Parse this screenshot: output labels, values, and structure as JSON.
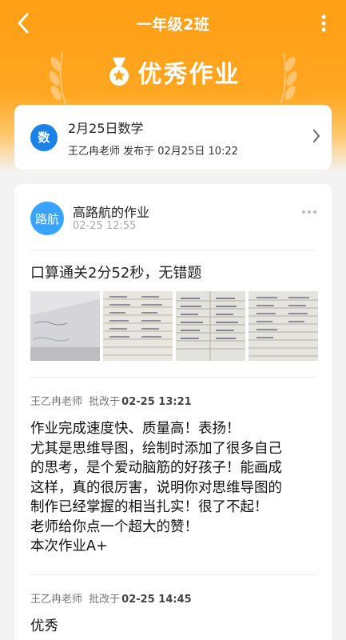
{
  "header": {
    "title": "一年级2班",
    "banner_title": "优秀作业"
  },
  "assignment": {
    "subject_badge": "数",
    "title": "2月25日数学",
    "meta": "王乙冉老师 发布于 02月25日 10:22"
  },
  "submission": {
    "avatar_text": "路航",
    "student_title": "高路航的作业",
    "time": "02-25 12:55",
    "text": "口算通关2分52秒，无错题",
    "photos": [
      "photo-1",
      "photo-2",
      "photo-3",
      "photo-4"
    ]
  },
  "comments": [
    {
      "teacher": "王乙冉老师",
      "action": "批改于",
      "time": "02-25 13:21",
      "lines": [
        "作业完成速度快、质量高！表扬！",
        "尤其是思维导图，绘制时添加了很多自己",
        "的思考，是个爱动脑筋的好孩子！能画成",
        "这样，真的很厉害，说明你对思维导图的",
        "制作已经掌握的相当扎实！很了不起！",
        "老师给你点一个超大的赞！",
        "本次作业A+"
      ]
    },
    {
      "teacher": "王乙冉老师",
      "action": "批改于",
      "time": "02-25 14:45",
      "lines": [
        "优秀"
      ]
    }
  ],
  "colors": {
    "accent": "#ffa621",
    "subject_blue": "#1b82e8",
    "avatar_blue": "#39a3ff"
  }
}
